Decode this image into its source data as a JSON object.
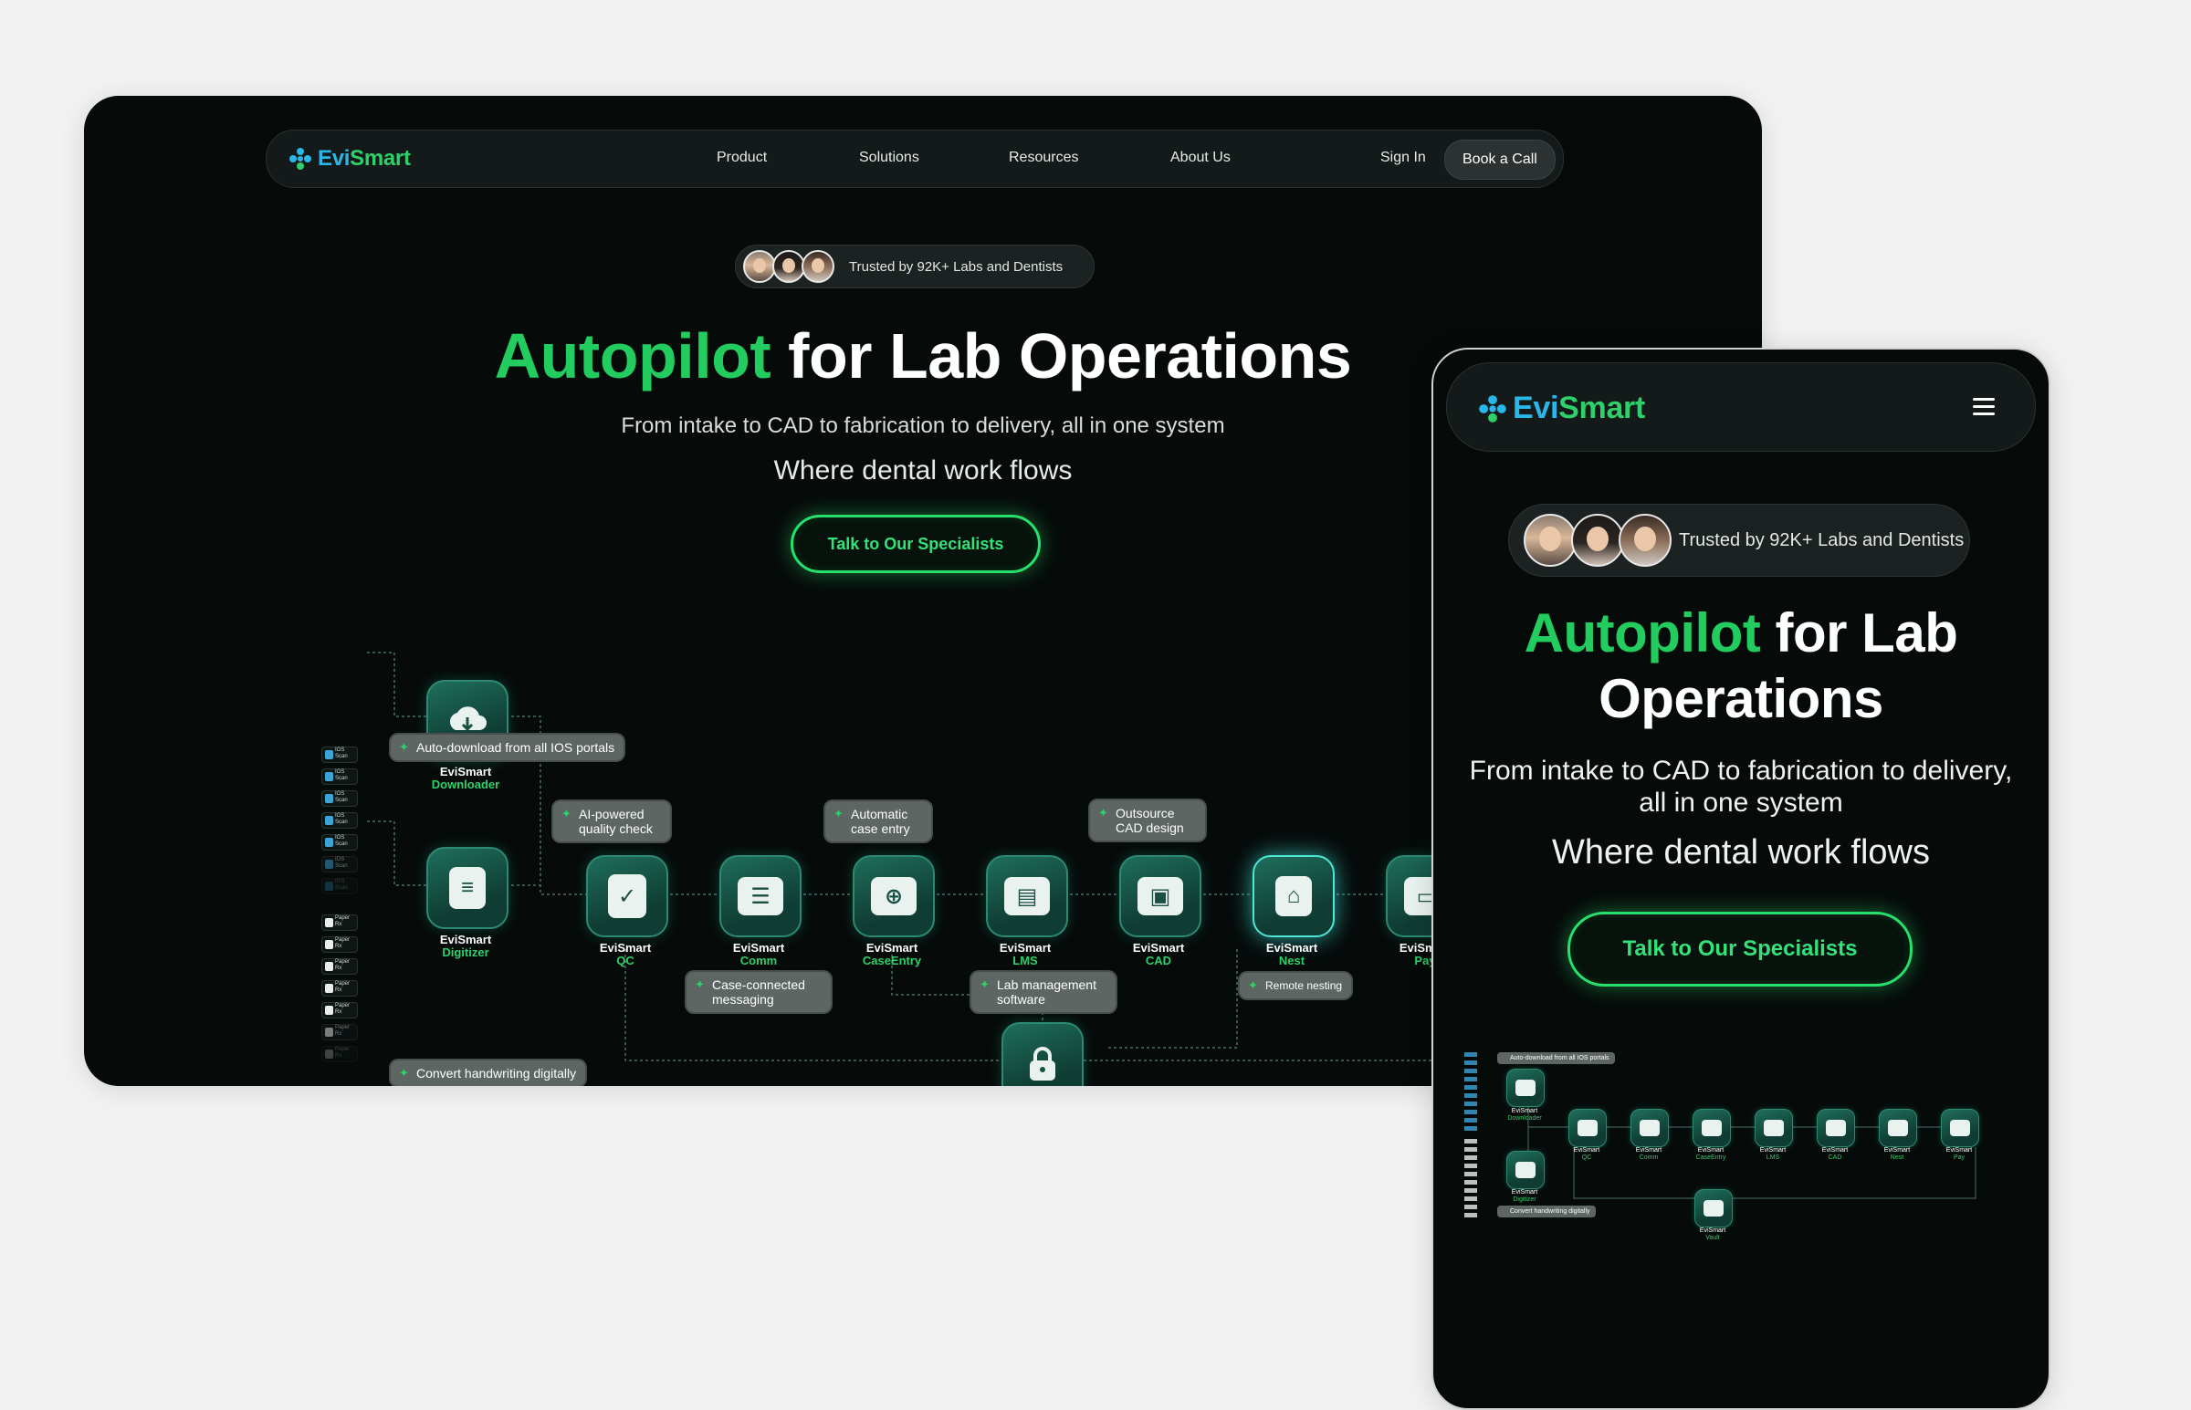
{
  "brand": {
    "word_evi": "Evi",
    "word_smart": "Smart"
  },
  "colors": {
    "accent_green": "#22cc5e",
    "brand_blue": "#29b6e8",
    "background_dark": "#060b0a",
    "canvas": "#f2f2f2"
  },
  "desktop": {
    "nav": {
      "links": [
        "Product",
        "Solutions",
        "Resources",
        "About Us"
      ],
      "sign_in": "Sign In",
      "book_call": "Book a Call"
    },
    "trust_badge": "Trusted by 92K+ Labs and Dentists",
    "hero": {
      "title_highlight": "Autopilot",
      "title_rest": " for Lab Operations",
      "subtitle": "From intake to CAD to fabrication to delivery, all in one system",
      "tagline": "Where dental work flows",
      "cta": "Talk to Our Specialists"
    },
    "diagram": {
      "inputs_ios": [
        "IOS Scan",
        "IOS Scan",
        "IOS Scan",
        "IOS Scan",
        "IOS Scan",
        "IOS Scan",
        "IOS Scan"
      ],
      "inputs_paper": [
        "Paper Rx",
        "Paper Rx",
        "Paper Rx",
        "Paper Rx",
        "Paper Rx",
        "Paper Rx",
        "Paper Rx"
      ],
      "nodes": [
        {
          "name": "EviSmart",
          "sub": "Downloader",
          "icon": "cloud-download-icon"
        },
        {
          "name": "EviSmart",
          "sub": "Digitizer",
          "icon": "scan-document-icon"
        },
        {
          "name": "EviSmart",
          "sub": "QC",
          "icon": "quality-check-icon"
        },
        {
          "name": "EviSmart",
          "sub": "Comm",
          "icon": "chat-icon"
        },
        {
          "name": "EviSmart",
          "sub": "CaseEntry",
          "icon": "case-entry-icon"
        },
        {
          "name": "EviSmart",
          "sub": "LMS",
          "icon": "lms-icon"
        },
        {
          "name": "EviSmart",
          "sub": "CAD",
          "icon": "cad-monitor-icon"
        },
        {
          "name": "EviSmart",
          "sub": "Nest",
          "icon": "nest-mill-icon"
        },
        {
          "name": "EviSmart",
          "sub": "Pay",
          "icon": "payment-icon"
        },
        {
          "name": "EviSmart",
          "sub": "Vault",
          "icon": "lock-icon"
        }
      ],
      "callouts": {
        "auto_download": "Auto-download from all IOS portals",
        "ai_qc": "AI-powered quality check",
        "auto_case": "Automatic case entry",
        "outsource": "Outsource CAD design",
        "case_msg": "Case-connected messaging",
        "lab_mgmt": "Lab management software",
        "remote_nest": "Remote nesting",
        "handwriting": "Convert handwriting digitally"
      }
    }
  },
  "mobile": {
    "trust_badge": "Trusted by 92K+ Labs and Dentists",
    "title_highlight": "Autopilot",
    "title_rest_line1": " for Lab",
    "title_line2": "Operations",
    "subtitle": "From intake to CAD to fabrication to delivery, all in one system",
    "tagline": "Where dental work flows",
    "cta": "Talk to Our Specialists",
    "menu_icon": "hamburger-menu-icon",
    "mini_callouts": {
      "auto_download": "Auto-download from all IOS portals",
      "handwriting": "Convert handwriting digitally"
    }
  }
}
